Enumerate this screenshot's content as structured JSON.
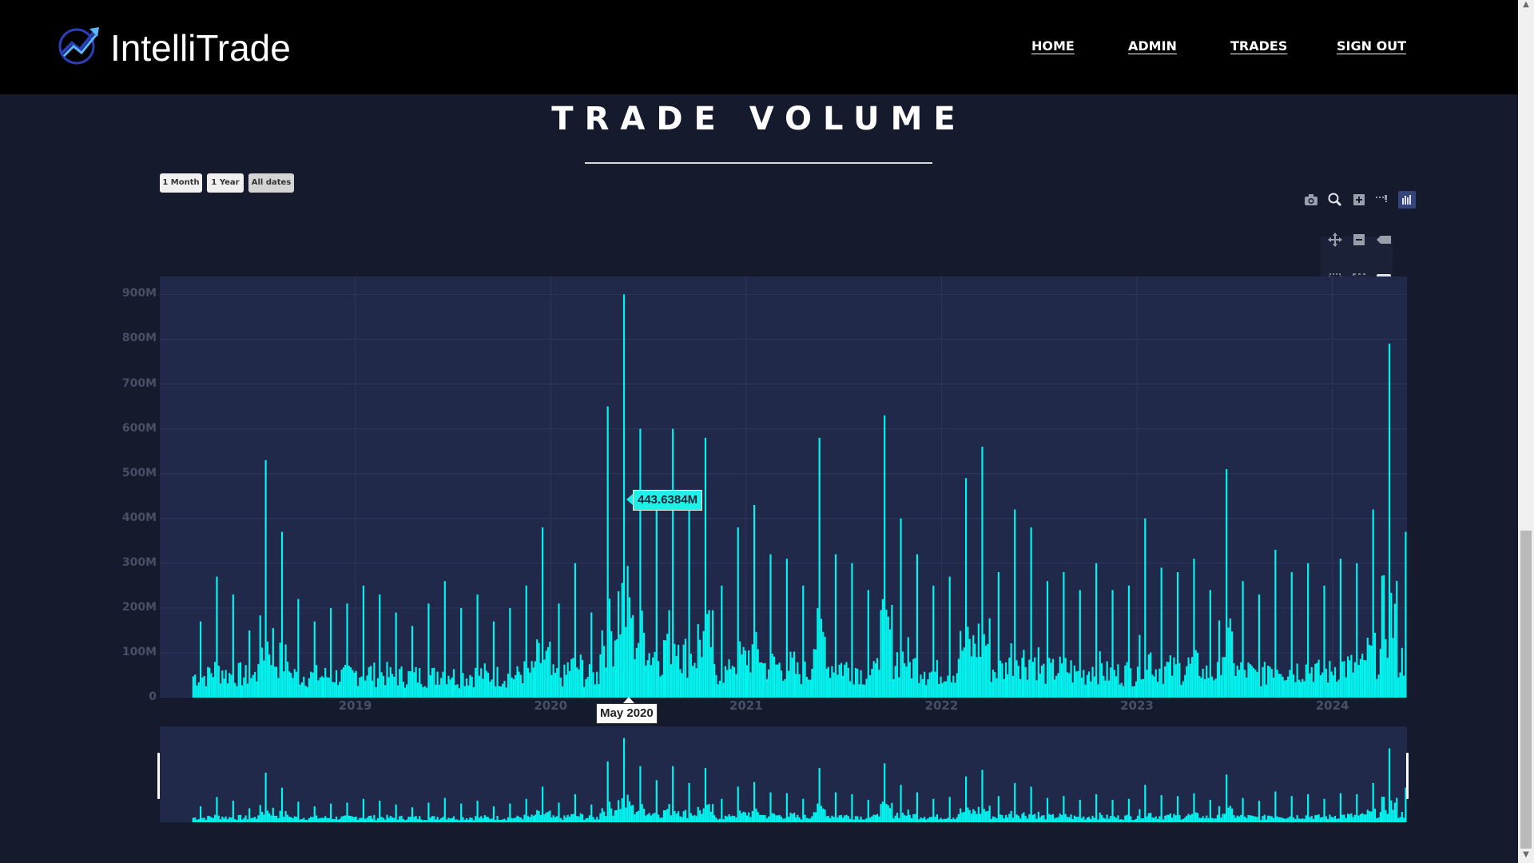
{
  "app": {
    "brand": "IntelliTrade",
    "logo_icon": "chart-trend-icon",
    "nav": [
      {
        "label": "HOME"
      },
      {
        "label": "ADMIN"
      },
      {
        "label": "TRADES"
      },
      {
        "label": "SIGN OUT"
      }
    ]
  },
  "page": {
    "title": "TRADE VOLUME"
  },
  "range_selector": {
    "buttons": [
      {
        "label": "1 Month",
        "active": false
      },
      {
        "label": "1 Year",
        "active": false
      },
      {
        "label": "All dates",
        "active": true
      }
    ]
  },
  "modebar": {
    "icons": [
      "camera-icon",
      "zoom-icon",
      "zoom-in-icon",
      "spike-lines-icon",
      "plotly-logo-icon",
      "pan-icon",
      "zoom-out-icon",
      "hover-closest-icon",
      "box-select-icon",
      "autoscale-icon",
      "hover-compare-icon",
      "lasso-icon",
      "reset-axes-icon"
    ]
  },
  "chart_data": {
    "type": "bar",
    "title": "TRADE VOLUME",
    "xlabel": "",
    "ylabel": "",
    "x_ticks": [
      "2019",
      "2020",
      "2021",
      "2022",
      "2023",
      "2024"
    ],
    "y_ticks": [
      "0",
      "100M",
      "200M",
      "300M",
      "400M",
      "500M",
      "600M",
      "700M",
      "800M",
      "900M"
    ],
    "ylim": [
      0,
      940
    ],
    "y_unit": "M",
    "bar_color": "#00f5f0",
    "grid": true,
    "range_slider": true,
    "hover": {
      "value_label": "443.6384M",
      "x_label": "May 2020"
    },
    "x": [
      "2018-03",
      "2018-04",
      "2018-05",
      "2018-06",
      "2018-07",
      "2018-08",
      "2018-09",
      "2018-10",
      "2018-11",
      "2018-12",
      "2019-01",
      "2019-02",
      "2019-03",
      "2019-04",
      "2019-05",
      "2019-06",
      "2019-07",
      "2019-08",
      "2019-09",
      "2019-10",
      "2019-11",
      "2019-12",
      "2020-01",
      "2020-02",
      "2020-03",
      "2020-04",
      "2020-05",
      "2020-06",
      "2020-07",
      "2020-08",
      "2020-09",
      "2020-10",
      "2020-11",
      "2020-12",
      "2021-01",
      "2021-02",
      "2021-03",
      "2021-04",
      "2021-05",
      "2021-06",
      "2021-07",
      "2021-08",
      "2021-09",
      "2021-10",
      "2021-11",
      "2021-12",
      "2022-01",
      "2022-02",
      "2022-03",
      "2022-04",
      "2022-05",
      "2022-06",
      "2022-07",
      "2022-08",
      "2022-09",
      "2022-10",
      "2022-11",
      "2022-12",
      "2023-01",
      "2023-02",
      "2023-03",
      "2023-04",
      "2023-05",
      "2023-06",
      "2023-07",
      "2023-08",
      "2023-09",
      "2023-10",
      "2023-11",
      "2023-12",
      "2024-01",
      "2024-02",
      "2024-03",
      "2024-04",
      "2024-05"
    ],
    "values": [
      170,
      270,
      230,
      150,
      530,
      370,
      220,
      170,
      200,
      210,
      250,
      230,
      190,
      160,
      210,
      260,
      200,
      230,
      170,
      200,
      250,
      380,
      210,
      300,
      190,
      650,
      900,
      600,
      450,
      600,
      420,
      580,
      250,
      380,
      430,
      320,
      310,
      250,
      580,
      320,
      300,
      240,
      630,
      400,
      320,
      250,
      270,
      490,
      560,
      280,
      420,
      380,
      260,
      280,
      240,
      300,
      240,
      250,
      400,
      290,
      280,
      310,
      240,
      510,
      260,
      230,
      330,
      280,
      300,
      250,
      310,
      300,
      420,
      790,
      370
    ]
  }
}
